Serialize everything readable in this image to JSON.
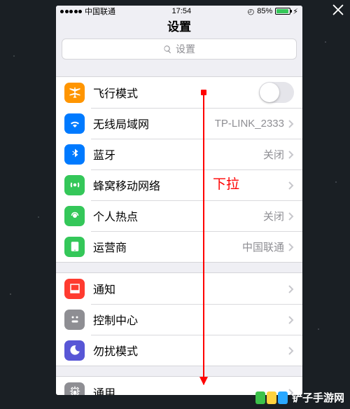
{
  "statusbar": {
    "carrier": "中国联通",
    "time": "17:54",
    "battery_pct": "85%",
    "battery_fill_width": "85%",
    "charge_glyph": "⚡︎",
    "clock_glyph": "◴"
  },
  "nav": {
    "title": "设置"
  },
  "search": {
    "placeholder": "设置"
  },
  "rows": {
    "airplane": {
      "label": "飞行模式",
      "icon_bg": "#ff9500"
    },
    "wifi": {
      "label": "无线局域网",
      "value": "TP-LINK_2333",
      "icon_bg": "#007aff"
    },
    "bluetooth": {
      "label": "蓝牙",
      "value": "关闭",
      "icon_bg": "#007aff"
    },
    "cellular": {
      "label": "蜂窝移动网络",
      "icon_bg": "#34c759"
    },
    "hotspot": {
      "label": "个人热点",
      "value": "关闭",
      "icon_bg": "#34c759"
    },
    "carrier": {
      "label": "运营商",
      "value": "中国联通",
      "icon_bg": "#34c759"
    },
    "notify": {
      "label": "通知",
      "icon_bg": "#ff3b30"
    },
    "control": {
      "label": "控制中心",
      "icon_bg": "#8e8e93"
    },
    "dnd": {
      "label": "勿扰模式",
      "icon_bg": "#5856d6"
    },
    "general": {
      "label": "通用",
      "icon_bg": "#8e8e93"
    }
  },
  "annotation": {
    "text": "下拉"
  },
  "watermark": {
    "text": "铲子手游网",
    "url": "http://czjxjc.com/"
  }
}
